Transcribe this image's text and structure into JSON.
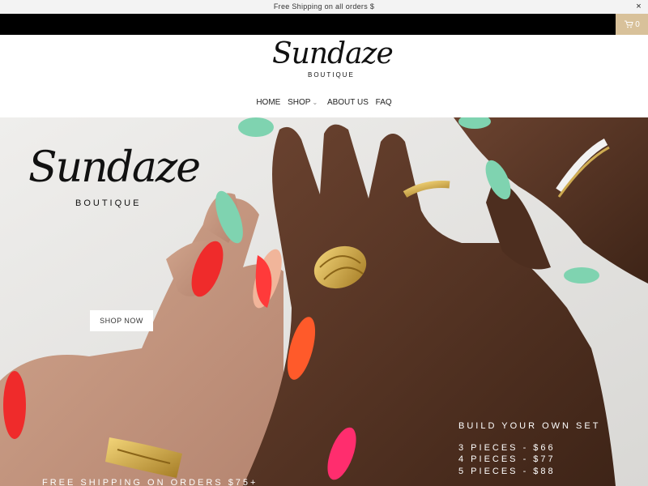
{
  "announcement": {
    "text": "Free Shipping on all orders $",
    "close_label": "×"
  },
  "cart": {
    "count": "0",
    "icon": "cart-icon"
  },
  "logo": {
    "script": "Sundaze",
    "sub": "BOUTIQUE"
  },
  "nav": {
    "items": [
      "HOME",
      "SHOP",
      "ABOUT US",
      "FAQ"
    ]
  },
  "hero": {
    "logo_script": "Sundaze",
    "logo_sub": "BOUTIQUE",
    "shop_button": "SHOP NOW",
    "promo_title": "BUILD YOUR OWN SET",
    "promo_lines": [
      "3 PIECES - $66",
      "4 PIECES - $77",
      "5 PIECES - $88"
    ],
    "bottom_text": "FREE SHIPPING ON ORDERS $75+"
  },
  "colors": {
    "cart_bg": "#d8c19a",
    "topbar": "#000000",
    "nail_mint": "#7fd3b0",
    "nail_red": "#ef2b2b",
    "nail_pink": "#ff2d6e"
  }
}
